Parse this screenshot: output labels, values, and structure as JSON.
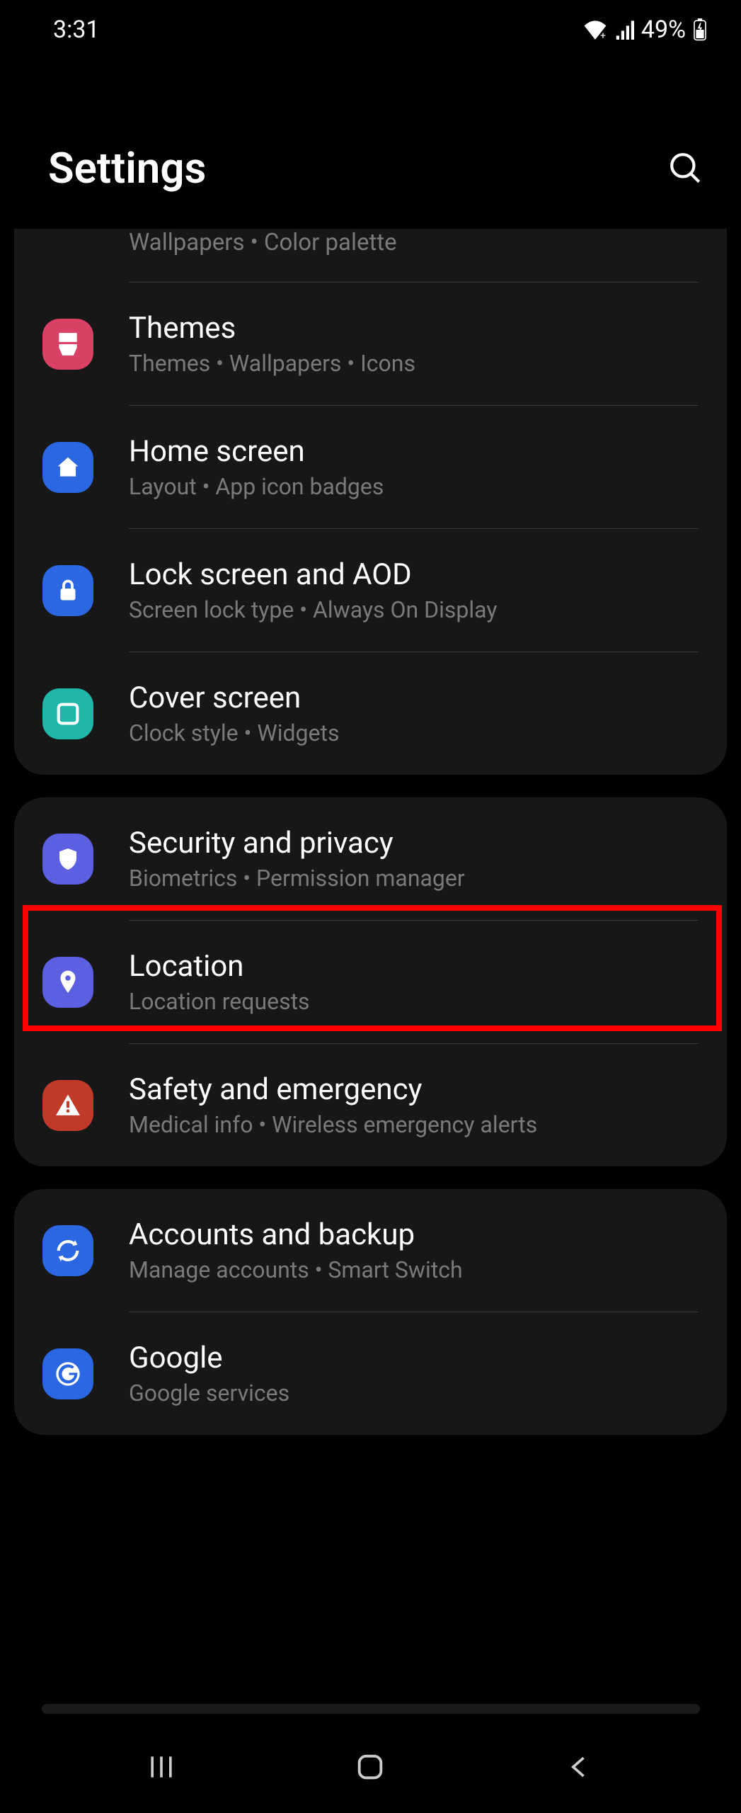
{
  "status": {
    "time": "3:31",
    "battery": "49%"
  },
  "header": {
    "title": "Settings"
  },
  "groups": [
    {
      "partial": {
        "subtitle": "Wallpapers  •  Color palette"
      },
      "items": [
        {
          "id": "themes",
          "title": "Themes",
          "subtitle": "Themes  •  Wallpapers  •  Icons",
          "color": "#d84064",
          "icon": "brush"
        },
        {
          "id": "home-screen",
          "title": "Home screen",
          "subtitle": "Layout  •  App icon badges",
          "color": "#2b67e3",
          "icon": "home"
        },
        {
          "id": "lock-screen",
          "title": "Lock screen and AOD",
          "subtitle": "Screen lock type  •  Always On Display",
          "color": "#2b67e3",
          "icon": "lock"
        },
        {
          "id": "cover-screen",
          "title": "Cover screen",
          "subtitle": "Clock style  •  Widgets",
          "color": "#1fb8a8",
          "icon": "cover"
        }
      ]
    },
    {
      "items": [
        {
          "id": "security-privacy",
          "title": "Security and privacy",
          "subtitle": "Biometrics  •  Permission manager",
          "color": "#5b5fe0",
          "icon": "shield",
          "highlighted": true
        },
        {
          "id": "location",
          "title": "Location",
          "subtitle": "Location requests",
          "color": "#5b5fe0",
          "icon": "pin"
        },
        {
          "id": "safety-emergency",
          "title": "Safety and emergency",
          "subtitle": "Medical info  •  Wireless emergency alerts",
          "color": "#c03a2a",
          "icon": "alert"
        }
      ]
    },
    {
      "items": [
        {
          "id": "accounts-backup",
          "title": "Accounts and backup",
          "subtitle": "Manage accounts  •  Smart Switch",
          "color": "#2b67e3",
          "icon": "sync"
        },
        {
          "id": "google",
          "title": "Google",
          "subtitle": "Google services",
          "color": "#2b67e3",
          "icon": "google"
        }
      ]
    }
  ]
}
